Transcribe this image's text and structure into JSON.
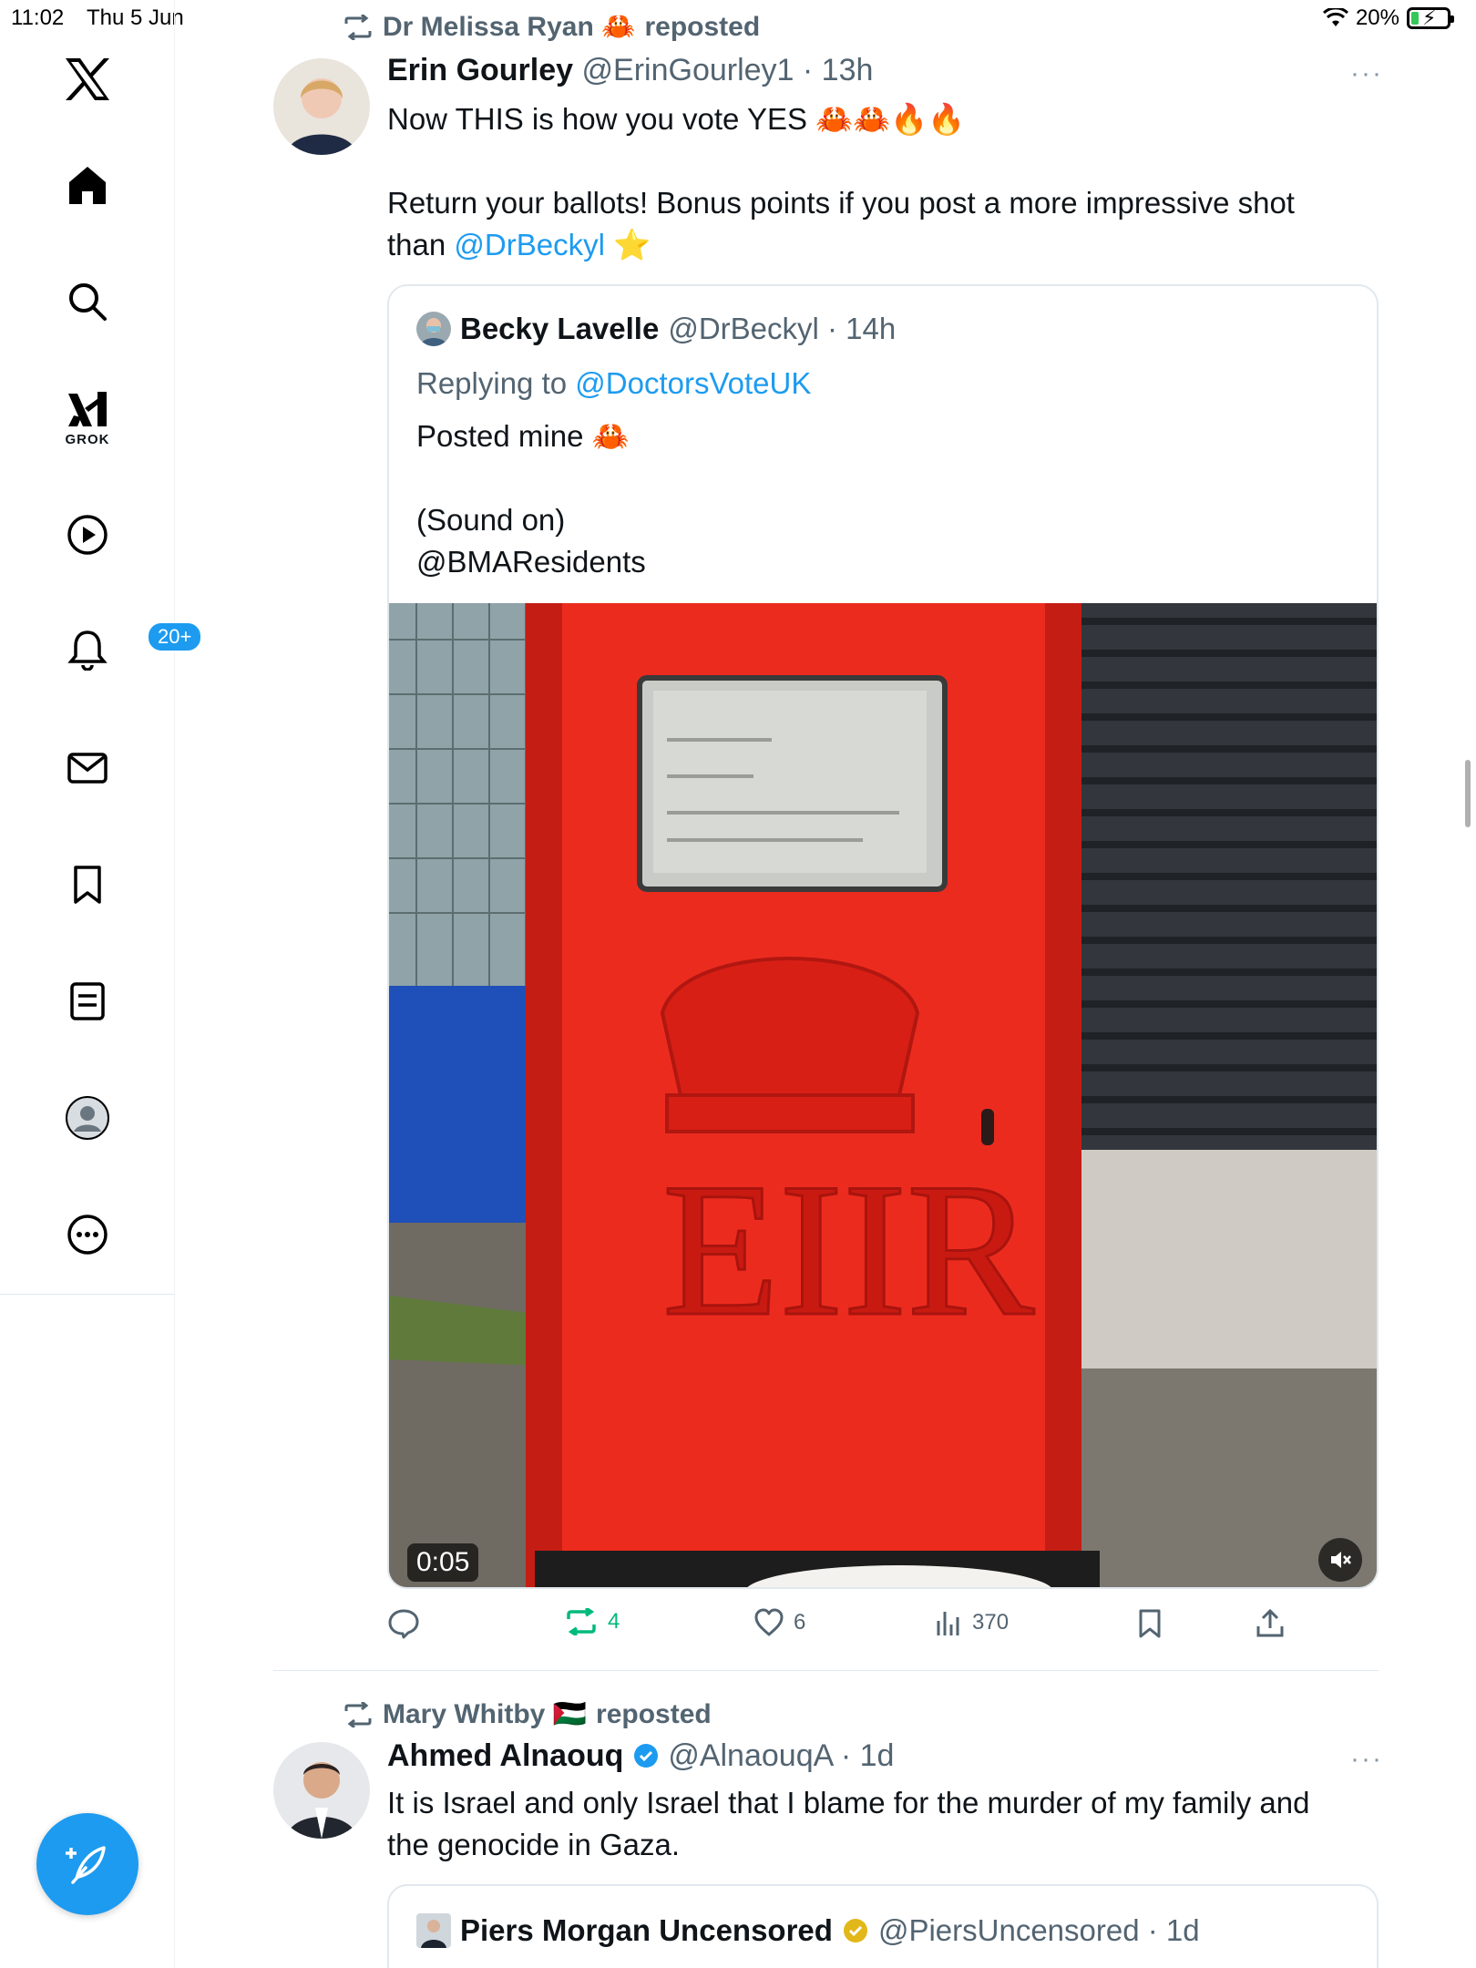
{
  "status_bar": {
    "time": "11:02",
    "date": "Thu 5 Jun",
    "battery": "20%",
    "battery_level": 0.2
  },
  "sidebar": {
    "grok_label": "GROK",
    "notifications_badge": "20+"
  },
  "tweets": [
    {
      "repost_by": "Dr Melissa Ryan 🦀",
      "repost_suffix": "reposted",
      "author_name": "Erin Gourley",
      "author_meta": "@ErinGourley1 · 13h",
      "more": "···",
      "line1": "Now THIS is how you vote YES 🦀🦀🔥🔥",
      "line2": "Return your ballots! Bonus points if you post a more impressive shot",
      "line3_prefix": "than ",
      "line3_link": "@DrBeckyl",
      "line3_suffix": " ⭐",
      "quote": {
        "author_name": "Becky Lavelle",
        "author_meta": "@DrBeckyl · 14h",
        "replying_prefix": "Replying to ",
        "replying_link": "@DoctorsVoteUK",
        "line1": "Posted mine 🦀",
        "line2": "(Sound on)",
        "line3": "@BMAResidents",
        "video_time": "0:05"
      },
      "actions": {
        "reposts": "4",
        "likes": "6",
        "views": "370"
      }
    },
    {
      "repost_by": "Mary Whitby 🇵🇸",
      "repost_suffix": "reposted",
      "author_name": "Ahmed Alnaouq",
      "author_meta": "@AlnaouqA · 1d",
      "more": "···",
      "line1": "It is Israel and only Israel that I blame for the murder of my family and",
      "line2": "the genocide in Gaza.",
      "quote": {
        "author_name": "Piers Morgan Uncensored",
        "author_meta": "@PiersUncensored · 1d"
      }
    }
  ],
  "colors": {
    "accent": "#1d9bf0",
    "repost_green": "#00ba7c",
    "muted": "#536471"
  }
}
